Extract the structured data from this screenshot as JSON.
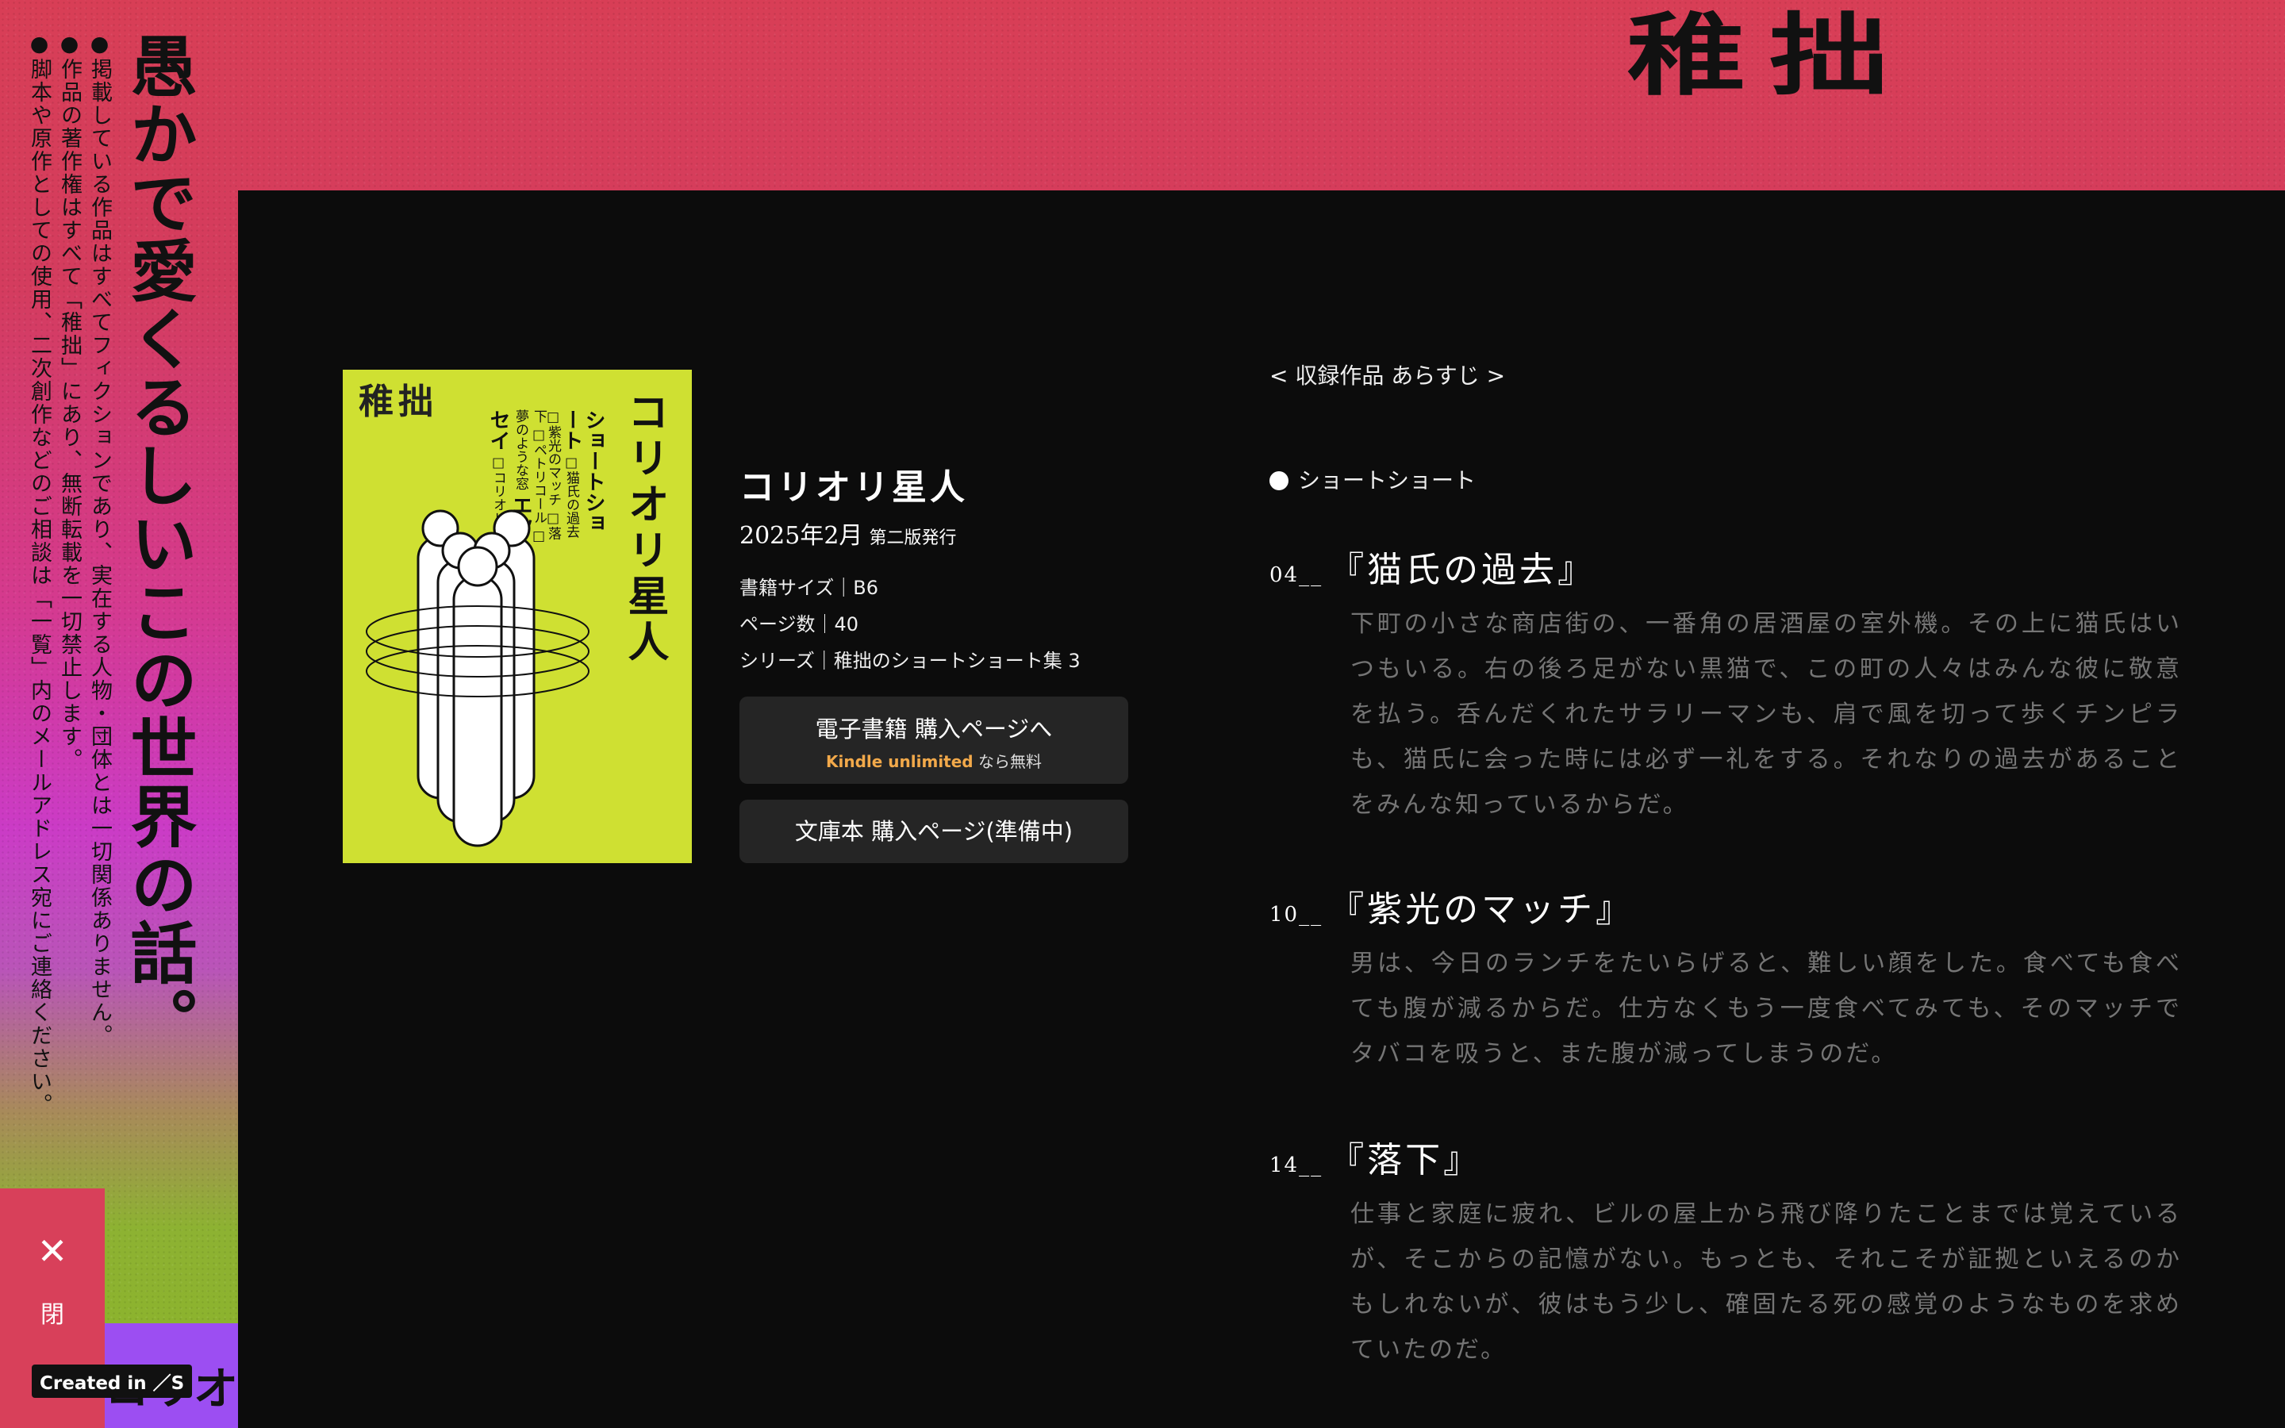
{
  "brand": {
    "logo": "稚拙"
  },
  "tagline": "愚かで愛くるしいこの世界の話。",
  "notices": [
    "●掲載している作品はすべてフィクションであり、実在する人物・団体とは一切関係ありません。",
    "●作品の著作権はすべて「稚拙」にあり、無断転載を一切禁止します。",
    "●脚本や原作としての使用、二次創作などのご相談は「一覧」内のメールアドレス宛にご連絡ください。"
  ],
  "cover": {
    "logo": "稚拙",
    "title": "コリオリ星人",
    "toc_heading_1": "ショートショート",
    "toc_items_1": [
      "□猫氏の過去",
      "□紫光のマッチ",
      "□落下",
      "□ペトリコール",
      "□夢のような窓"
    ],
    "toc_heading_2": "エッセイ",
    "toc_items_2": [
      "□コリオリ星人"
    ]
  },
  "book": {
    "title": "コリオリ星人",
    "date": "2025年2月",
    "edition": "第二版発行",
    "size": "書籍サイズ｜B6",
    "pages": "ページ数｜40",
    "series": "シリーズ｜稚拙のショートショート集 3"
  },
  "buttons": {
    "ebook": "電子書籍 購入ページへ",
    "kindle_brand": "Kindle unlimited",
    "kindle_suffix": "なら無料",
    "paperback": "文庫本 購入ページ(準備中)"
  },
  "synopsis": {
    "heading": "< 収録作品 あらすじ >",
    "category": "ショートショート",
    "stories": [
      {
        "num": "04__",
        "title": "『猫氏の過去』",
        "body": "下町の小さな商店街の、一番角の居酒屋の室外機。その上に猫氏はいつもいる。右の後ろ足がない黒猫で、この町の人々はみんな彼に敬意を払う。呑んだくれたサラリーマンも、肩で風を切って歩くチンピラも、猫氏に会った時には必ず一礼をする。それなりの過去があることをみんな知っているからだ。"
      },
      {
        "num": "10__",
        "title": "『紫光のマッチ』",
        "body": "男は、今日のランチをたいらげると、難しい顔をした。食べても食べても腹が減るからだ。仕方なくもう一度食べてみても、そのマッチでタバコを吸うと、また腹が減ってしまうのだ。"
      },
      {
        "num": "14__",
        "title": "『落下』",
        "body": "仕事と家庭に疲れ、ビルの屋上から飛び降りたことまでは覚えているが、そこからの記憶がない。もっとも、それこそが証拠といえるのかもしれないが、彼はもう少し、確固たる死の感覚のようなものを求めていたのだ。"
      }
    ]
  },
  "close": {
    "icon": "close-icon",
    "label": "閉"
  },
  "peek_text": "コリオリ",
  "created_badge": "Created in ／S"
}
